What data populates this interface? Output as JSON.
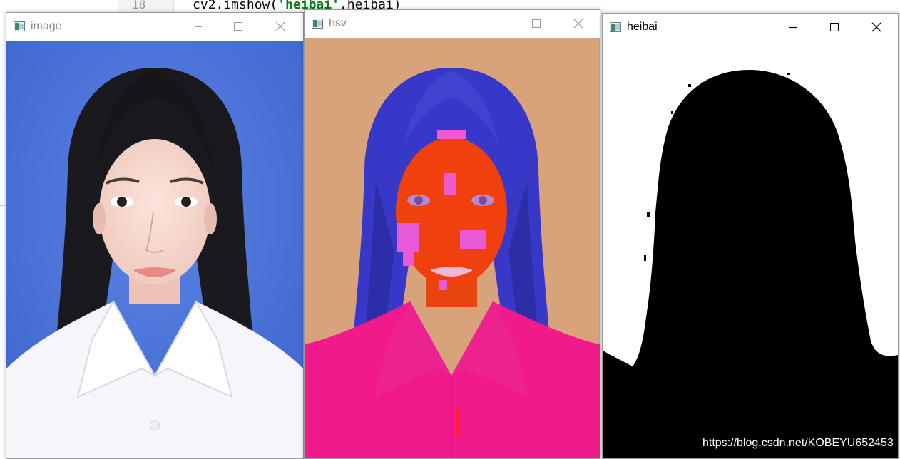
{
  "editor": {
    "line_number": "18",
    "code_prefix": "cv2.imshow(",
    "code_string": "'heibai'",
    "code_suffix": ",heibai)"
  },
  "windows": [
    {
      "title": "image",
      "active": false
    },
    {
      "title": "hsv",
      "active": false
    },
    {
      "title": "heibai",
      "active": true
    }
  ],
  "watermark": "https://blog.csdn.net/KOBEYU652453",
  "colors": {
    "photo_background": "#4a72d6",
    "hsv_background": "#d8a27a",
    "hsv_hair": "#3838c8",
    "hsv_face": "#f0400e",
    "hsv_shirt": "#f01a8a",
    "mask_foreground": "#000000",
    "mask_background": "#ffffff"
  }
}
